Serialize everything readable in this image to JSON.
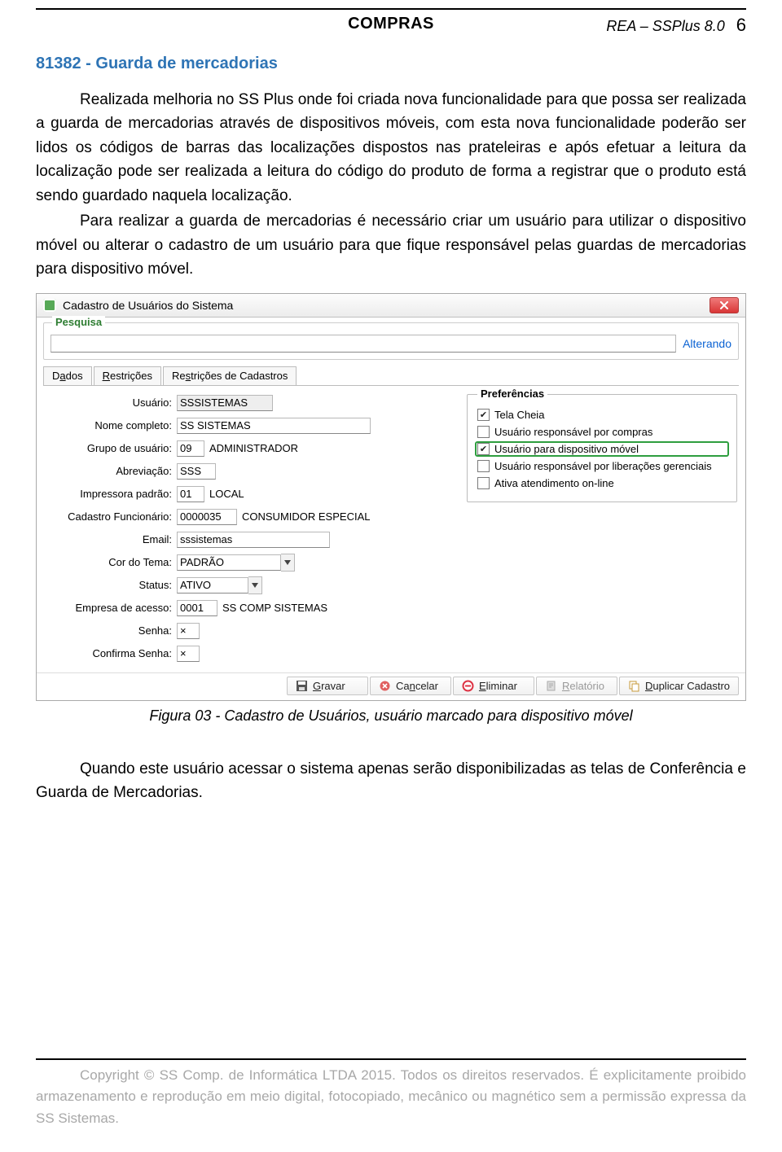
{
  "header": {
    "doc_id": "REA – SSPlus 8.0",
    "page_num": "6",
    "title": "COMPRAS"
  },
  "section_heading": "81382 - Guarda de mercadorias",
  "paragraph1": "Realizada melhoria no SS Plus onde foi criada nova funcionalidade para que possa ser realizada a guarda de mercadorias através de dispositivos móveis, com esta nova funcionalidade poderão ser lidos os códigos de barras das localizações dispostos nas prateleiras e após efetuar a leitura da localização pode ser realizada a leitura do código do produto de forma a registrar que o produto está sendo guardado naquela localização.",
  "paragraph2": "Para realizar a guarda de mercadorias é necessário criar um usuário para utilizar o dispositivo móvel ou alterar o cadastro de um usuário para que fique responsável pelas guardas de mercadorias para dispositivo móvel.",
  "caption": "Figura 03 - Cadastro de Usuários, usuário marcado para dispositivo móvel",
  "paragraph3": "Quando este usuário acessar o sistema apenas serão disponibilizadas as telas de Conferência e Guarda de Mercadorias.",
  "footer_text": "Copyright © SS Comp. de Informática LTDA 2015. Todos os direitos reservados. É explicitamente proibido  armazenamento e reprodução em meio digital, fotocopiado, mecânico ou magnético sem a permissão expressa da SS Sistemas.",
  "window": {
    "title": "Cadastro de Usuários do Sistema",
    "search_legend": "Pesquisa",
    "alter_label": "Alterando",
    "tabs": [
      {
        "pre": "D",
        "u": "a",
        "post": "dos"
      },
      {
        "pre": "",
        "u": "R",
        "post": "estrições"
      },
      {
        "pre": "Re",
        "u": "s",
        "post": "trições de Cadastros"
      }
    ],
    "prefs_legend": "Preferências",
    "prefs": [
      {
        "label": "Tela Cheia",
        "checked": true
      },
      {
        "label": "Usuário responsável por compras",
        "checked": false
      },
      {
        "label": "Usuário para dispositivo móvel",
        "checked": true,
        "highlight": true
      },
      {
        "label": "Usuário responsável por liberações gerenciais",
        "checked": false
      },
      {
        "label": "Ativa atendimento on-line",
        "checked": false
      }
    ],
    "form": {
      "usuario": {
        "label": "Usuário:",
        "value": "SSSISTEMAS"
      },
      "nome": {
        "label": "Nome completo:",
        "value": "SS SISTEMAS"
      },
      "grupo": {
        "label": "Grupo de usuário:",
        "code": "09",
        "text": "ADMINISTRADOR"
      },
      "abrev": {
        "label": "Abreviação:",
        "value": "SSS"
      },
      "impressora": {
        "label": "Impressora padrão:",
        "code": "01",
        "text": "LOCAL"
      },
      "cad_func": {
        "label": "Cadastro Funcionário:",
        "code": "0000035",
        "text": "CONSUMIDOR ESPECIAL"
      },
      "email": {
        "label": "Email:",
        "value": "sssistemas"
      },
      "tema": {
        "label": "Cor do Tema:",
        "value": "PADRÃO"
      },
      "status": {
        "label": "Status:",
        "value": "ATIVO"
      },
      "empresa": {
        "label": "Empresa de acesso:",
        "code": "0001",
        "text": "SS COMP SISTEMAS"
      },
      "senha": {
        "label": "Senha:",
        "value": "×"
      },
      "conf_senha": {
        "label": "Confirma Senha:",
        "value": "×"
      }
    },
    "toolbar": {
      "gravar": {
        "u": "G",
        "rest": "ravar"
      },
      "cancelar": {
        "pre": "Ca",
        "u": "n",
        "rest": "celar"
      },
      "eliminar": {
        "u": "E",
        "rest": "liminar"
      },
      "relatorio": {
        "u": "R",
        "rest": "elatório"
      },
      "duplicar": {
        "u": "D",
        "rest": "uplicar Cadastro"
      }
    }
  }
}
